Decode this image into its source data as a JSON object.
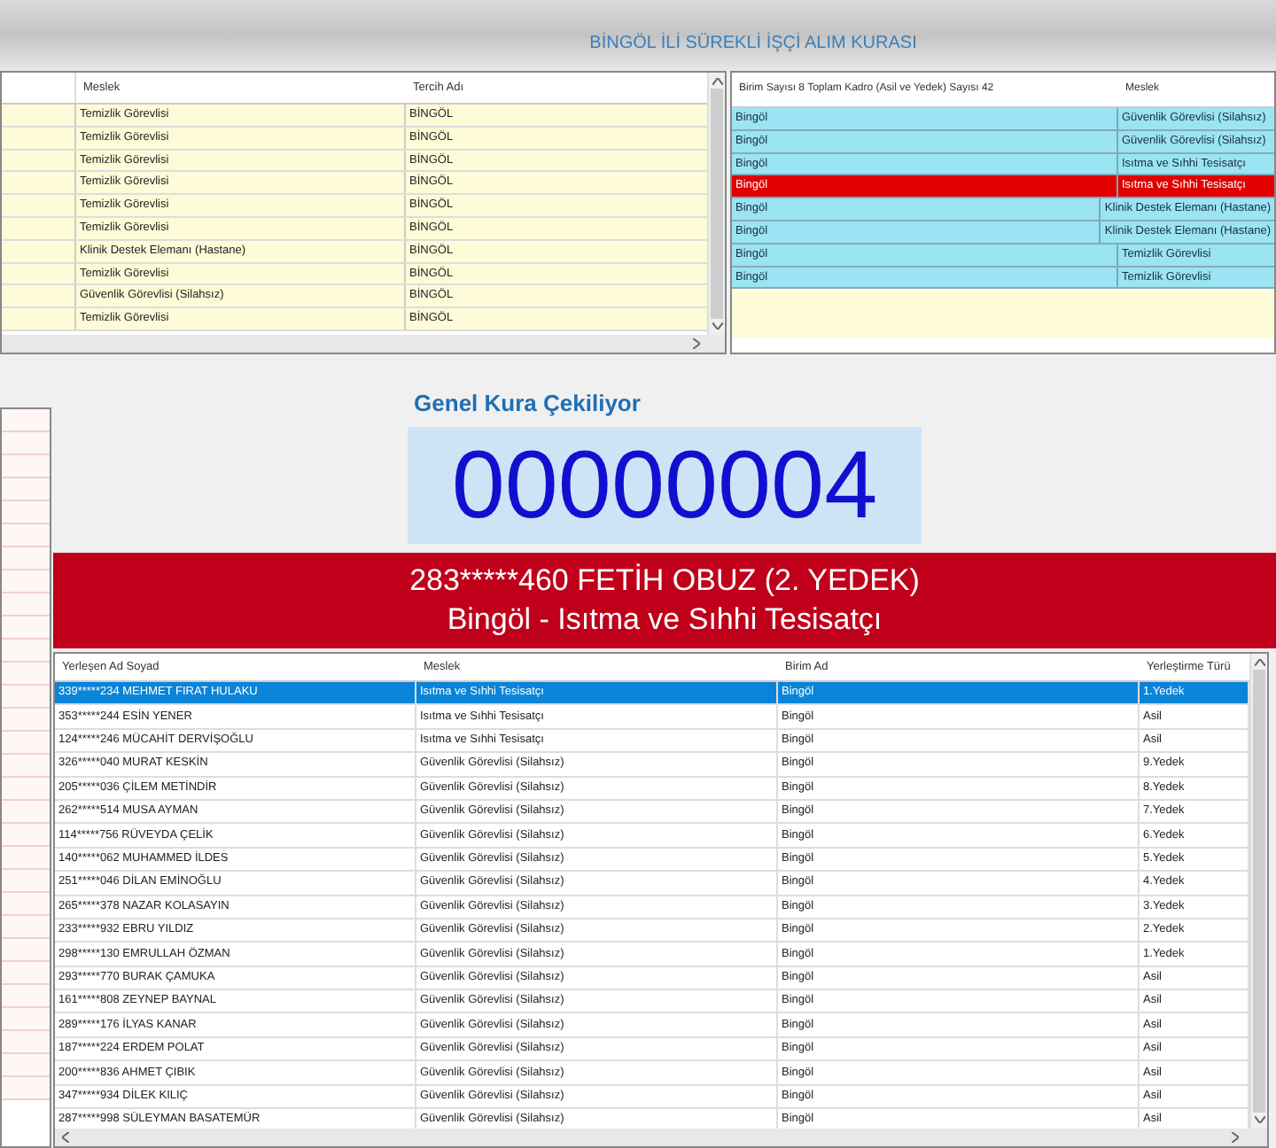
{
  "title": "BİNGÖL İLİ SÜREKLİ İŞÇİ ALIM KURASI",
  "preferences_table": {
    "columns": [
      "Meslek",
      "Tercih Adı"
    ],
    "rows": [
      {
        "cells": [
          "Temizlik Görevlisi",
          "BİNGÖL"
        ]
      },
      {
        "cells": [
          "Temizlik Görevlisi",
          "BİNGÖL"
        ]
      },
      {
        "cells": [
          "Temizlik Görevlisi",
          "BİNGÖL"
        ]
      },
      {
        "cells": [
          "Temizlik Görevlisi",
          "BİNGÖL"
        ]
      },
      {
        "cells": [
          "Temizlik Görevlisi",
          "BİNGÖL"
        ]
      },
      {
        "cells": [
          "Temizlik Görevlisi",
          "BİNGÖL"
        ]
      },
      {
        "cells": [
          "Klinik Destek Elemanı (Hastane)",
          "BİNGÖL"
        ]
      },
      {
        "cells": [
          "Temizlik Görevlisi",
          "BİNGÖL"
        ]
      },
      {
        "cells": [
          "Güvenlik Görevlisi (Silahsız)",
          "BİNGÖL"
        ]
      },
      {
        "cells": [
          "Temizlik Görevlisi",
          "BİNGÖL"
        ]
      }
    ]
  },
  "quota_table": {
    "columns": [
      "Birim Sayısı 8 Toplam Kadro (Asil ve Yedek) Sayısı 42",
      "Meslek"
    ],
    "rows": [
      {
        "cells": [
          "Bingöl",
          "Güvenlik Görevlisi (Silahsız)"
        ],
        "selected": false
      },
      {
        "cells": [
          "Bingöl",
          "Güvenlik Görevlisi (Silahsız)"
        ],
        "selected": false
      },
      {
        "cells": [
          "Bingöl",
          "Isıtma ve Sıhhi Tesisatçı"
        ],
        "selected": false
      },
      {
        "cells": [
          "Bingöl",
          "Isıtma ve Sıhhi Tesisatçı"
        ],
        "selected": true
      },
      {
        "cells": [
          "Bingöl",
          "Klinik Destek Elemanı (Hastane)"
        ],
        "selected": false
      },
      {
        "cells": [
          "Bingöl",
          "Klinik Destek Elemanı (Hastane)"
        ],
        "selected": false
      },
      {
        "cells": [
          "Bingöl",
          "Temizlik Görevlisi"
        ],
        "selected": false
      },
      {
        "cells": [
          "Bingöl",
          "Temizlik Görevlisi"
        ],
        "selected": false
      }
    ]
  },
  "draw": {
    "label": "Genel Kura Çekiliyor",
    "number": "00000004",
    "winner": "283*****460 FETİH OBUZ (2. YEDEK)",
    "position": "Bingöl - Isıtma ve Sıhhi Tesisatçı"
  },
  "results_table": {
    "columns": [
      "Yerleşen Ad Soyad",
      "Meslek",
      "Birim Ad",
      "Yerleştirme Türü"
    ],
    "rows": [
      {
        "cells": [
          "339*****234 MEHMET FIRAT HULAKU",
          "Isıtma ve Sıhhi Tesisatçı",
          "Bingöl",
          "1.Yedek"
        ],
        "selected": true
      },
      {
        "cells": [
          "353*****244 ESİN YENER",
          "Isıtma ve Sıhhi Tesisatçı",
          "Bingöl",
          "Asil"
        ],
        "selected": false
      },
      {
        "cells": [
          "124*****246 MÜCAHİT DERVİŞOĞLU",
          "Isıtma ve Sıhhi Tesisatçı",
          "Bingöl",
          "Asil"
        ],
        "selected": false
      },
      {
        "cells": [
          "326*****040 MURAT KESKİN",
          "Güvenlik Görevlisi (Silahsız)",
          "Bingöl",
          "9.Yedek"
        ],
        "selected": false
      },
      {
        "cells": [
          "205*****036 ÇİLEM METİNDİR",
          "Güvenlik Görevlisi (Silahsız)",
          "Bingöl",
          "8.Yedek"
        ],
        "selected": false
      },
      {
        "cells": [
          "262*****514 MUSA AYMAN",
          "Güvenlik Görevlisi (Silahsız)",
          "Bingöl",
          "7.Yedek"
        ],
        "selected": false
      },
      {
        "cells": [
          "114*****756 RÜVEYDA ÇELİK",
          "Güvenlik Görevlisi (Silahsız)",
          "Bingöl",
          "6.Yedek"
        ],
        "selected": false
      },
      {
        "cells": [
          "140*****062 MUHAMMED İLDES",
          "Güvenlik Görevlisi (Silahsız)",
          "Bingöl",
          "5.Yedek"
        ],
        "selected": false
      },
      {
        "cells": [
          "251*****046 DİLAN EMİNOĞLU",
          "Güvenlik Görevlisi (Silahsız)",
          "Bingöl",
          "4.Yedek"
        ],
        "selected": false
      },
      {
        "cells": [
          "265*****378 NAZAR KOLASAYIN",
          "Güvenlik Görevlisi (Silahsız)",
          "Bingöl",
          "3.Yedek"
        ],
        "selected": false
      },
      {
        "cells": [
          "233*****932 EBRU YILDIZ",
          "Güvenlik Görevlisi (Silahsız)",
          "Bingöl",
          "2.Yedek"
        ],
        "selected": false
      },
      {
        "cells": [
          "298*****130 EMRULLAH ÖZMAN",
          "Güvenlik Görevlisi (Silahsız)",
          "Bingöl",
          "1.Yedek"
        ],
        "selected": false
      },
      {
        "cells": [
          "293*****770 BURAK ÇAMUKA",
          "Güvenlik Görevlisi (Silahsız)",
          "Bingöl",
          "Asil"
        ],
        "selected": false
      },
      {
        "cells": [
          "161*****808 ZEYNEP BAYNAL",
          "Güvenlik Görevlisi (Silahsız)",
          "Bingöl",
          "Asil"
        ],
        "selected": false
      },
      {
        "cells": [
          "289*****176 İLYAS KANAR",
          "Güvenlik Görevlisi (Silahsız)",
          "Bingöl",
          "Asil"
        ],
        "selected": false
      },
      {
        "cells": [
          "187*****224 ERDEM POLAT",
          "Güvenlik Görevlisi (Silahsız)",
          "Bingöl",
          "Asil"
        ],
        "selected": false
      },
      {
        "cells": [
          "200*****836 AHMET ÇIBIK",
          "Güvenlik Görevlisi (Silahsız)",
          "Bingöl",
          "Asil"
        ],
        "selected": false
      },
      {
        "cells": [
          "347*****934 DİLEK KILIÇ",
          "Güvenlik Görevlisi (Silahsız)",
          "Bingöl",
          "Asil"
        ],
        "selected": false
      },
      {
        "cells": [
          "287*****998 SÜLEYMAN BASATEMÜR",
          "Güvenlik Görevlisi (Silahsız)",
          "Bingöl",
          "Asil"
        ],
        "selected": false
      }
    ]
  }
}
